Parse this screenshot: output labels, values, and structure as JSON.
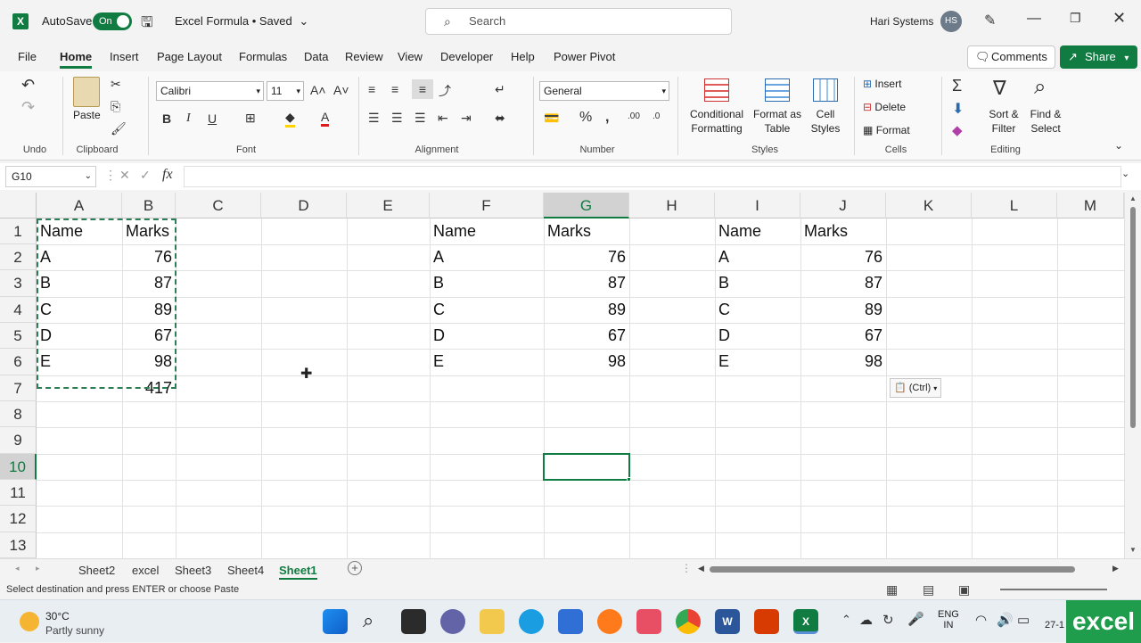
{
  "titlebar": {
    "autosave_label": "AutoSave",
    "autosave_state": "On",
    "doc_title": "Excel Formula • Saved",
    "search_placeholder": "Search",
    "user_name": "Hari Systems",
    "user_initials": "HS"
  },
  "menu": {
    "items": [
      "File",
      "Home",
      "Insert",
      "Page Layout",
      "Formulas",
      "Data",
      "Review",
      "View",
      "Developer",
      "Help",
      "Power Pivot"
    ],
    "active": "Home",
    "comments_label": "Comments",
    "share_label": "Share"
  },
  "ribbon": {
    "groups": {
      "undo": "Undo",
      "clipboard": "Clipboard",
      "font": "Font",
      "alignment": "Alignment",
      "number": "Number",
      "styles": "Styles",
      "cells": "Cells",
      "editing": "Editing"
    },
    "paste_label": "Paste",
    "font_name": "Calibri",
    "font_size": "11",
    "number_format": "General",
    "conditional_formatting": [
      "Conditional",
      "Formatting"
    ],
    "format_as_table": [
      "Format as",
      "Table"
    ],
    "cell_styles": [
      "Cell",
      "Styles"
    ],
    "insert_label": "Insert",
    "delete_label": "Delete",
    "format_label": "Format",
    "sort_filter": [
      "Sort &",
      "Filter"
    ],
    "find_select": [
      "Find &",
      "Select"
    ]
  },
  "formula_bar": {
    "name_box": "G10",
    "fx": "fx",
    "formula": ""
  },
  "grid": {
    "columns": [
      "A",
      "B",
      "C",
      "D",
      "E",
      "F",
      "G",
      "H",
      "I",
      "J",
      "K",
      "L",
      "M"
    ],
    "rows": [
      "1",
      "2",
      "3",
      "4",
      "5",
      "6",
      "7",
      "8",
      "9",
      "10",
      "11",
      "12",
      "13"
    ],
    "selected_column": "G",
    "selected_row": "10",
    "table1": {
      "header": [
        "Name",
        "Marks"
      ],
      "rows": [
        [
          "A",
          "76"
        ],
        [
          "B",
          "87"
        ],
        [
          "C",
          "89"
        ],
        [
          "D",
          "67"
        ],
        [
          "E",
          "98"
        ]
      ],
      "total": "417"
    },
    "table2": {
      "header": [
        "Name",
        "Marks"
      ],
      "rows": [
        [
          "A",
          "76"
        ],
        [
          "B",
          "87"
        ],
        [
          "C",
          "89"
        ],
        [
          "D",
          "67"
        ],
        [
          "E",
          "98"
        ]
      ]
    },
    "table3": {
      "header": [
        "Name",
        "Marks"
      ],
      "rows": [
        [
          "A",
          "76"
        ],
        [
          "B",
          "87"
        ],
        [
          "C",
          "89"
        ],
        [
          "D",
          "67"
        ],
        [
          "E",
          "98"
        ]
      ]
    },
    "paste_options_label": "(Ctrl)"
  },
  "sheets": {
    "tabs": [
      "Sheet2",
      "excel",
      "Sheet3",
      "Sheet4",
      "Sheet1"
    ],
    "active": "Sheet1"
  },
  "status": {
    "message": "Select destination and press ENTER or choose Paste"
  },
  "taskbar": {
    "weather_temp": "30°C",
    "weather_desc": "Partly sunny",
    "lang_line1": "ENG",
    "lang_line2": "IN",
    "date_partial": "27-1",
    "watermark": "excel"
  },
  "colors": {
    "accent": "#107c41",
    "ribbon_bg": "#f9f9f9",
    "chrome_bg": "#f3f3f3"
  }
}
